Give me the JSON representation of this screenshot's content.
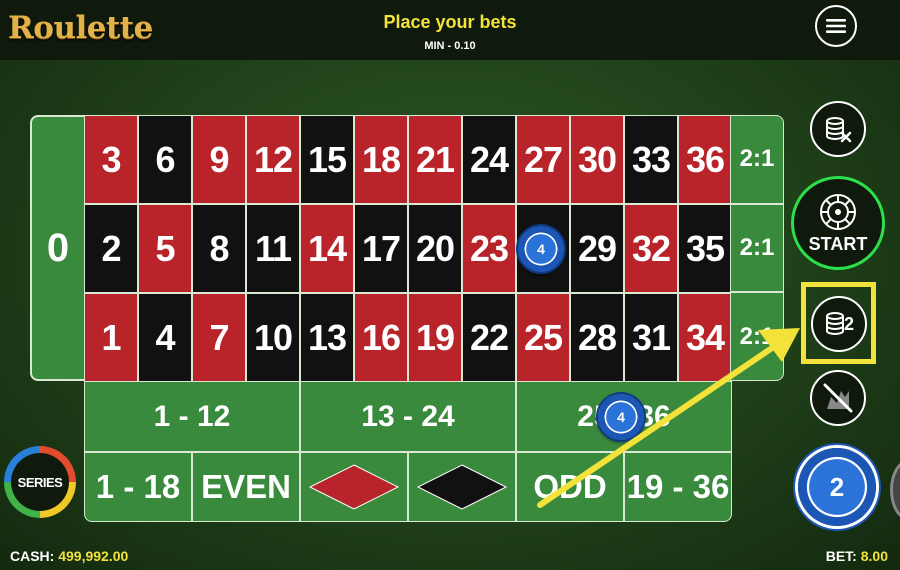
{
  "header": {
    "logo": "Roulette",
    "title": "Place your bets",
    "min_bet": "MIN - 0.10",
    "menu_icon": "hamburger-menu-icon"
  },
  "table": {
    "zero": "0",
    "numbers": [
      {
        "n": "3",
        "c": "red"
      },
      {
        "n": "2",
        "c": "black"
      },
      {
        "n": "1",
        "c": "red"
      },
      {
        "n": "6",
        "c": "black"
      },
      {
        "n": "5",
        "c": "red"
      },
      {
        "n": "4",
        "c": "black"
      },
      {
        "n": "9",
        "c": "red"
      },
      {
        "n": "8",
        "c": "black"
      },
      {
        "n": "7",
        "c": "red"
      },
      {
        "n": "12",
        "c": "red"
      },
      {
        "n": "11",
        "c": "black"
      },
      {
        "n": "10",
        "c": "black"
      },
      {
        "n": "15",
        "c": "black"
      },
      {
        "n": "14",
        "c": "red"
      },
      {
        "n": "13",
        "c": "black"
      },
      {
        "n": "18",
        "c": "red"
      },
      {
        "n": "17",
        "c": "black"
      },
      {
        "n": "16",
        "c": "red"
      },
      {
        "n": "21",
        "c": "red"
      },
      {
        "n": "20",
        "c": "black"
      },
      {
        "n": "19",
        "c": "red"
      },
      {
        "n": "24",
        "c": "black"
      },
      {
        "n": "23",
        "c": "red"
      },
      {
        "n": "22",
        "c": "black"
      },
      {
        "n": "27",
        "c": "red"
      },
      {
        "n": "26",
        "c": "black"
      },
      {
        "n": "25",
        "c": "red"
      },
      {
        "n": "30",
        "c": "red"
      },
      {
        "n": "29",
        "c": "black"
      },
      {
        "n": "28",
        "c": "black"
      },
      {
        "n": "33",
        "c": "black"
      },
      {
        "n": "32",
        "c": "red"
      },
      {
        "n": "31",
        "c": "black"
      },
      {
        "n": "36",
        "c": "red"
      },
      {
        "n": "35",
        "c": "black"
      },
      {
        "n": "34",
        "c": "red"
      }
    ],
    "column_bets": [
      "2:1",
      "2:1",
      "2:1"
    ],
    "dozens": [
      "1 - 12",
      "13 - 24",
      "25 - 36"
    ],
    "outside": {
      "low": "1 - 18",
      "even": "EVEN",
      "odd": "ODD",
      "high": "19 - 36"
    },
    "colors": {
      "red": "#b8242a",
      "black": "#111111",
      "felt": "#3a8a3d"
    }
  },
  "chips": {
    "on_26": "4",
    "on_25_36": "4",
    "selected_value": "2"
  },
  "side_buttons": {
    "clear_icon": "clear-bets-icon",
    "start_label": "START",
    "double_label": "2",
    "undo_icon": "undo-icon"
  },
  "series_label": "SERIES",
  "footer": {
    "cash_label": "CASH:",
    "cash_value": "499,992.00",
    "bet_label": "BET:",
    "bet_value": "8.00"
  },
  "annotation": {
    "highlight_color": "#f2e23a"
  }
}
